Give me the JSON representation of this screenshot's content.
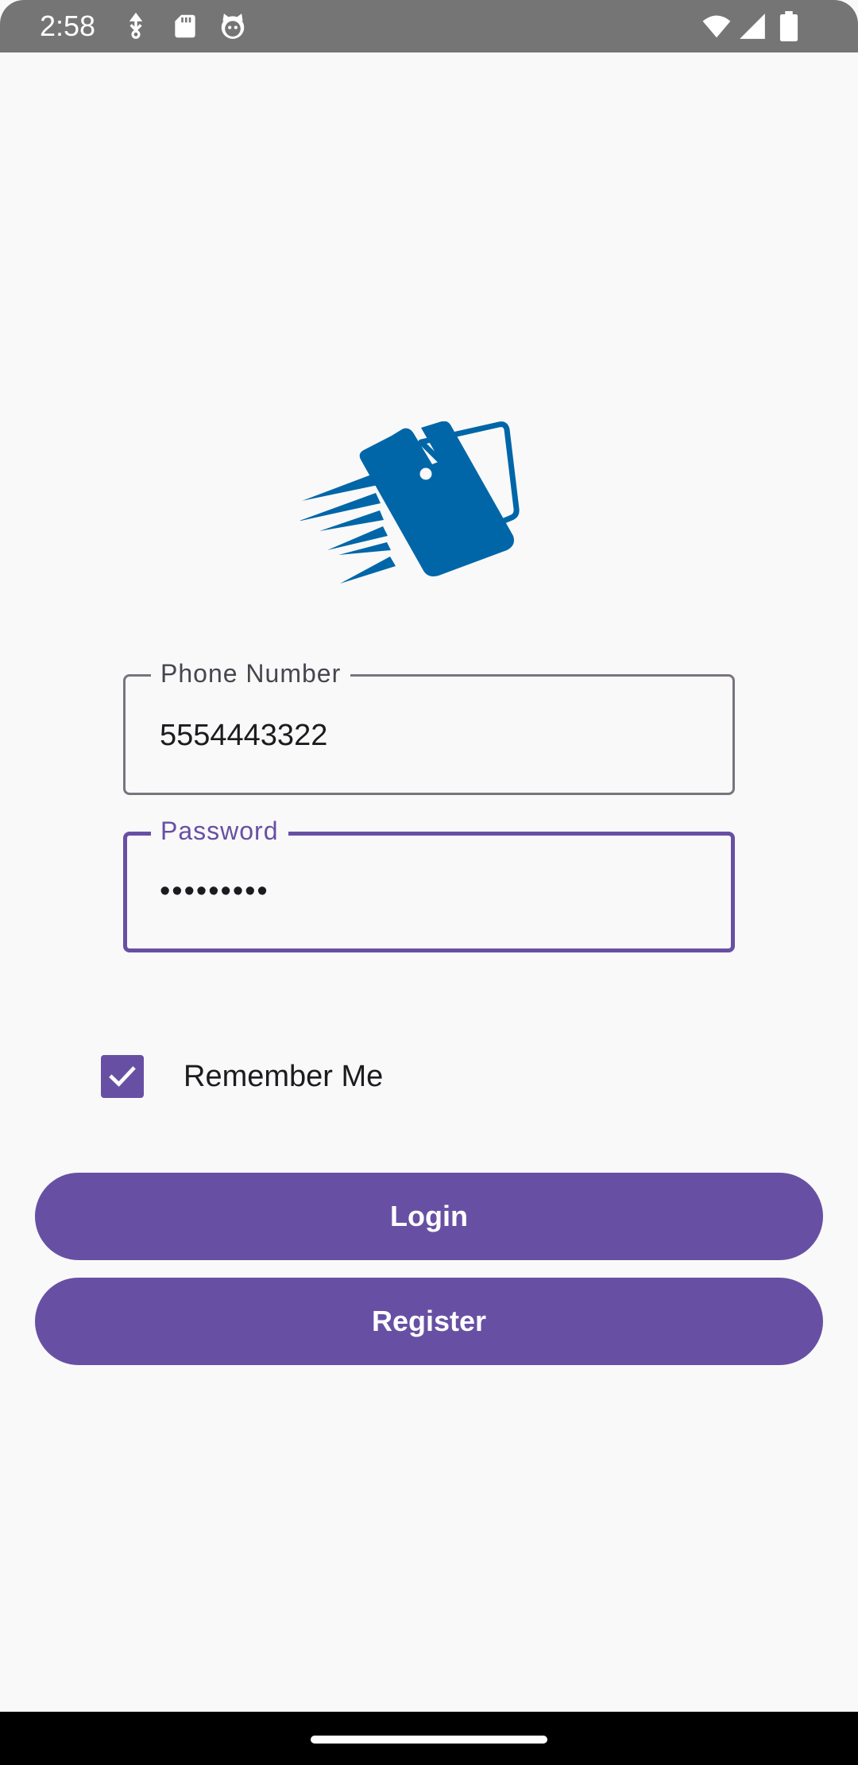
{
  "status_bar": {
    "time": "2:58",
    "icons": [
      "usb-debug-icon",
      "sd-card-icon",
      "cat-notification-icon",
      "wifi-icon",
      "signal-icon",
      "battery-icon"
    ]
  },
  "logo": {
    "icon": "wallet-fast-logo",
    "color": "#0066a8"
  },
  "phone_field": {
    "label": "Phone Number",
    "value": "5554443322"
  },
  "password_field": {
    "label": "Password",
    "value": "•••••••••"
  },
  "remember_me": {
    "label": "Remember Me",
    "checked": true
  },
  "buttons": {
    "login": "Login",
    "register": "Register"
  },
  "colors": {
    "primary": "#6750a4",
    "status_bar": "#757575",
    "background": "#f9f9f9"
  }
}
